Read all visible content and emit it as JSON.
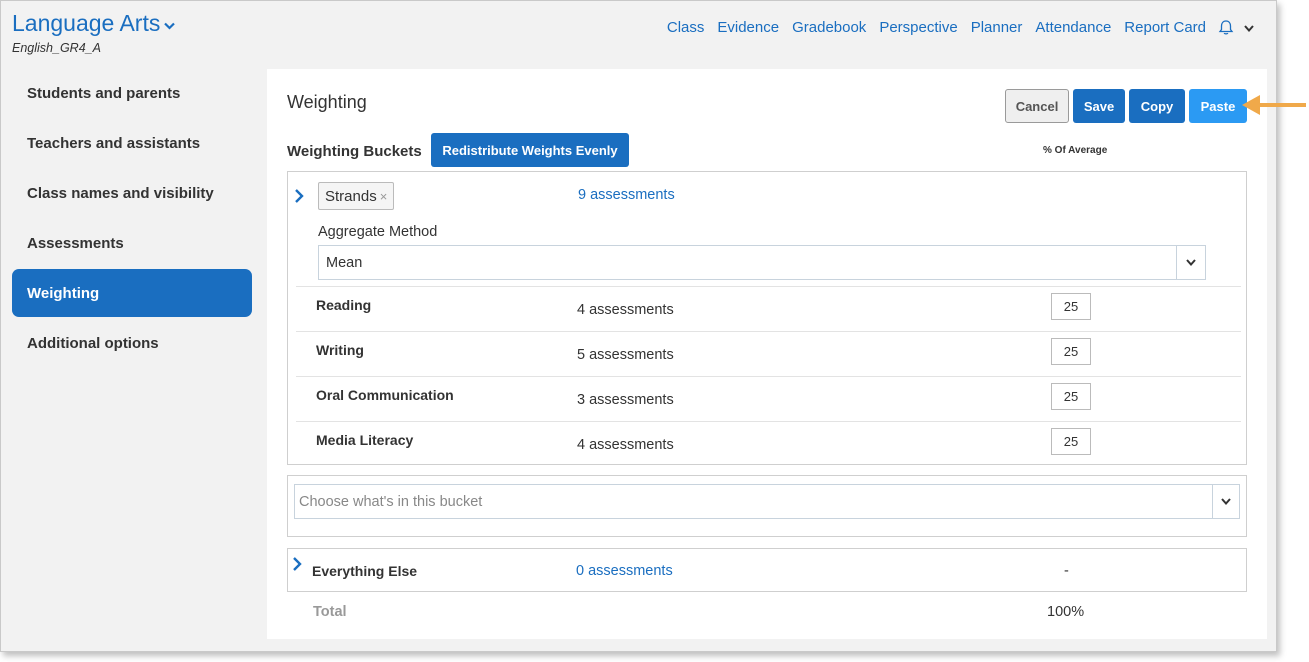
{
  "app": {
    "title": "Language Arts",
    "subtitle": "English_GR4_A"
  },
  "topnav": {
    "items": [
      "Class",
      "Evidence",
      "Gradebook",
      "Perspective",
      "Planner",
      "Attendance",
      "Report Card"
    ],
    "icons": [
      "bell-icon",
      "chevron-down-icon"
    ]
  },
  "sidebar": {
    "items": [
      {
        "label": "Students and parents",
        "active": false
      },
      {
        "label": "Teachers and assistants",
        "active": false
      },
      {
        "label": "Class names and visibility",
        "active": false
      },
      {
        "label": "Assessments",
        "active": false
      },
      {
        "label": "Weighting",
        "active": true
      },
      {
        "label": "Additional options",
        "active": false
      }
    ]
  },
  "main": {
    "title": "Weighting",
    "actions": {
      "cancel": "Cancel",
      "save": "Save",
      "copy": "Copy",
      "paste": "Paste"
    },
    "weighting_buckets_label": "Weighting Buckets",
    "redistribute_label": "Redistribute Weights Evenly",
    "pct_header": "% Of Average",
    "bucket": {
      "tag": "Strands",
      "tag_remove": "×",
      "assessments": "9 assessments",
      "aggregate_label": "Aggregate Method",
      "aggregate_value": "Mean",
      "strands": [
        {
          "name": "Reading",
          "count": "4 assessments",
          "weight": "25"
        },
        {
          "name": "Writing",
          "count": "5 assessments",
          "weight": "25"
        },
        {
          "name": "Oral Communication",
          "count": "3 assessments",
          "weight": "25"
        },
        {
          "name": "Media Literacy",
          "count": "4 assessments",
          "weight": "25"
        }
      ]
    },
    "choose_placeholder": "Choose what's in this bucket",
    "everything_else": {
      "name": "Everything Else",
      "count": "0 assessments",
      "pct": "-"
    },
    "total": {
      "label": "Total",
      "value": "100%"
    }
  },
  "colors": {
    "brand_blue": "#1a6ec0",
    "paste_blue": "#2b9af3",
    "annotation_arrow": "#f0a94a"
  }
}
